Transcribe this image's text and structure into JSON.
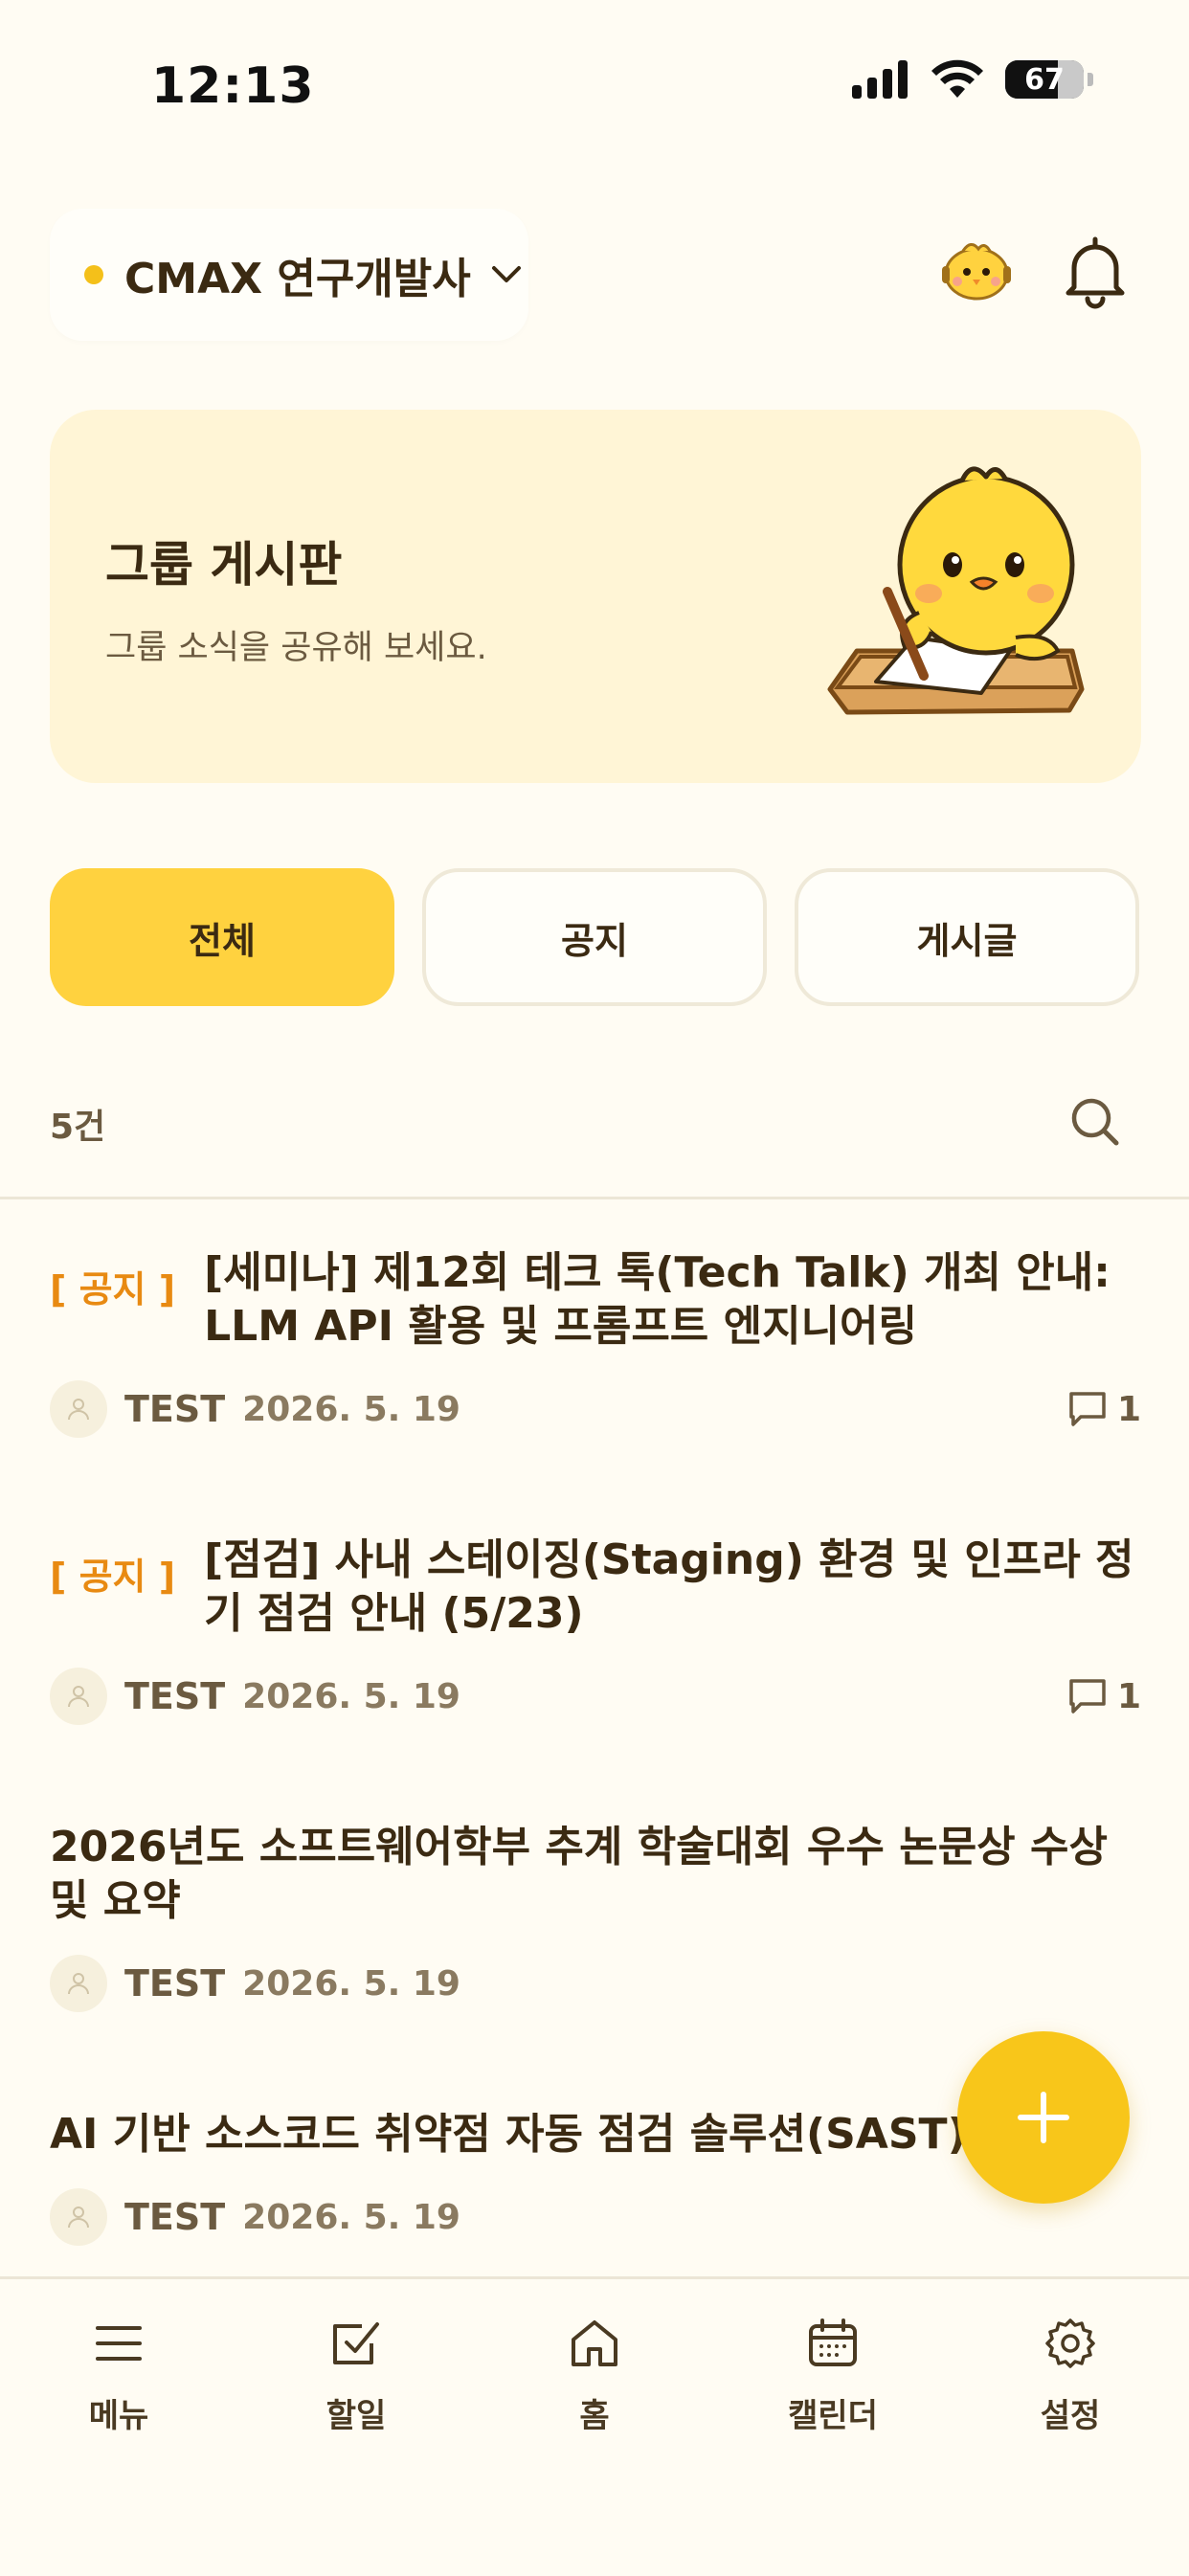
{
  "status_bar": {
    "time": "12:13",
    "battery": "67"
  },
  "header": {
    "group_name": "CMAX 연구개발사"
  },
  "banner": {
    "title": "그룹 게시판",
    "subtitle": "그룹 소식을 공유해 보세요."
  },
  "tabs": [
    {
      "label": "전체",
      "active": true
    },
    {
      "label": "공지",
      "active": false
    },
    {
      "label": "게시글",
      "active": false
    }
  ],
  "list": {
    "count": "5건"
  },
  "posts": [
    {
      "badge": "[ 공지 ]",
      "title": "[세미나] 제12회 테크 톡(Tech Talk) 개최 안내: LLM API 활용 및 프롬프트 엔지니어링",
      "author": "TEST",
      "date": "2026. 5. 19",
      "comments": "1"
    },
    {
      "badge": "[ 공지 ]",
      "title": "[점검] 사내 스테이징(Staging) 환경 및 인프라 정기 점검 안내 (5/23)",
      "author": "TEST",
      "date": "2026. 5. 19",
      "comments": "1"
    },
    {
      "badge": "",
      "title": "2026년도 소프트웨어학부 추계 학술대회 우수 논문상 수상 및 요약",
      "author": "TEST",
      "date": "2026. 5. 19",
      "comments": ""
    },
    {
      "badge": "",
      "title": "AI 기반 소스코드 취약점 자동 점검 솔루션(SAST) 도입 안",
      "author": "TEST",
      "date": "2026. 5. 19",
      "comments": ""
    }
  ],
  "bottom_nav": [
    {
      "label": "메뉴",
      "icon": "menu-icon"
    },
    {
      "label": "할일",
      "icon": "checkbox-icon"
    },
    {
      "label": "홈",
      "icon": "home-icon"
    },
    {
      "label": "캘린더",
      "icon": "calendar-icon"
    },
    {
      "label": "설정",
      "icon": "gear-icon"
    }
  ],
  "colors": {
    "accent": "#ffd23f",
    "badge": "#e88a12",
    "background": "#fffcf3"
  }
}
